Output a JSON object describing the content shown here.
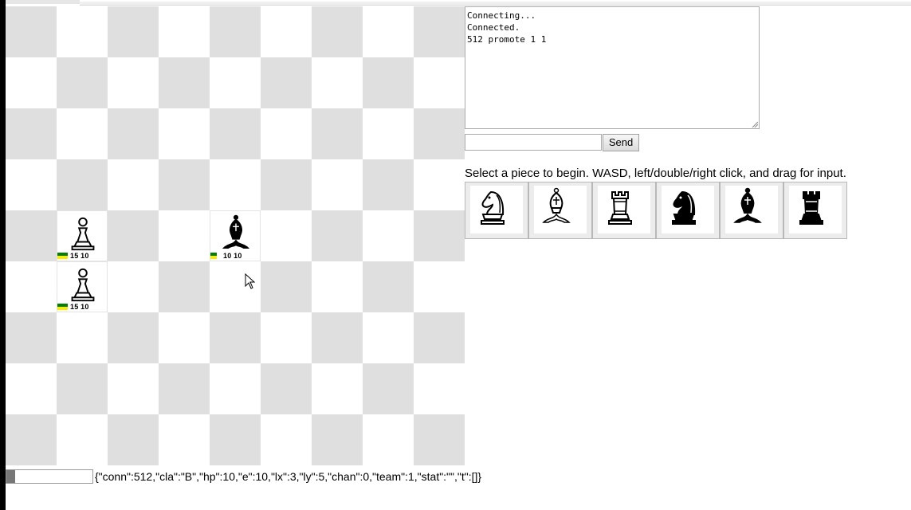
{
  "board": {
    "pieces": [
      {
        "col": 1,
        "row": 4,
        "kind": "pawn",
        "color": "white",
        "stats": "15 10",
        "hp_bars": "full"
      },
      {
        "col": 4,
        "row": 4,
        "kind": "bishop",
        "color": "black",
        "stats": "10 10",
        "hp_bars": "short"
      },
      {
        "col": 1,
        "row": 5,
        "kind": "pawn",
        "color": "white",
        "stats": "15 10",
        "hp_bars": "full"
      }
    ]
  },
  "log": {
    "lines": [
      "Connecting...",
      "Connected.",
      "512 promote 1 1"
    ]
  },
  "chat": {
    "input_value": "",
    "send_label": "Send"
  },
  "instructions": "Select a piece to begin. WASD, left/double/right click, and drag for input.",
  "piece_choices": [
    {
      "name": "white-knight-icon",
      "kind": "knight",
      "color": "white"
    },
    {
      "name": "white-bishop-icon",
      "kind": "bishop",
      "color": "white"
    },
    {
      "name": "white-rook-icon",
      "kind": "rook",
      "color": "white"
    },
    {
      "name": "black-knight-icon",
      "kind": "knight",
      "color": "black"
    },
    {
      "name": "black-bishop-icon",
      "kind": "bishop",
      "color": "black"
    },
    {
      "name": "black-rook-icon",
      "kind": "rook",
      "color": "black"
    }
  ],
  "status": {
    "progress_fraction": 0.1,
    "json_text": "{\"conn\":512,\"cla\":\"B\",\"hp\":10,\"e\":10,\"lx\":3,\"ly\":5,\"chan\":0,\"team\":1,\"stat\":\"\",\"t\":[]}"
  },
  "colors": {
    "dark_square": "#dfdfdf",
    "light_square": "#ffffff",
    "hp_green": "#008000",
    "hp_yellow": "#ffeb00"
  }
}
